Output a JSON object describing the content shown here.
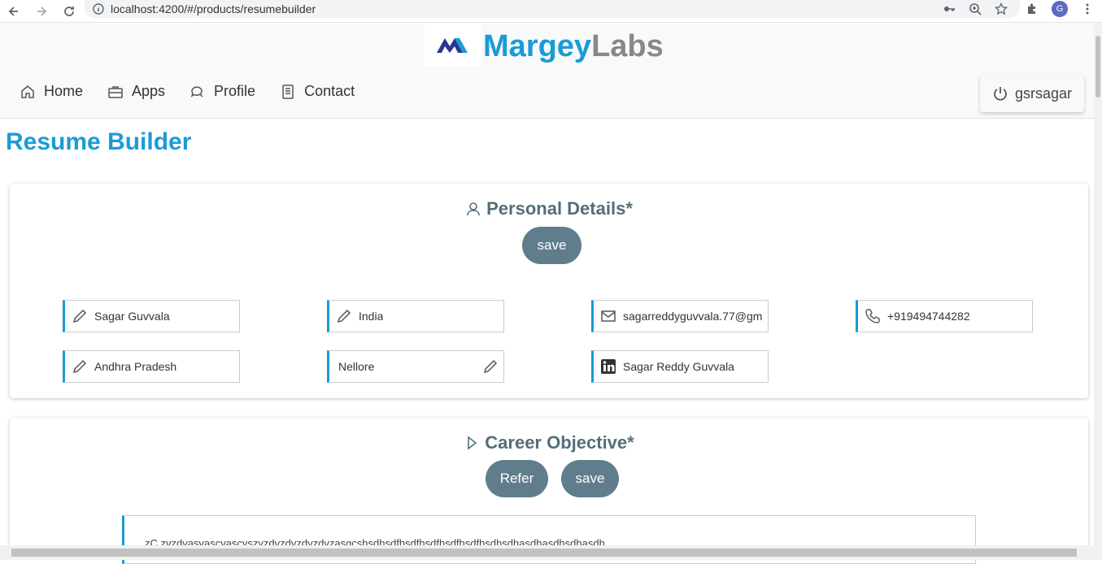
{
  "browser": {
    "url": "localhost:4200/#/products/resumebuilder",
    "profile_initial": "G"
  },
  "header": {
    "logo_primary": "Margey",
    "logo_secondary": "Labs",
    "nav": [
      {
        "label": "Home",
        "icon": "home-icon"
      },
      {
        "label": "Apps",
        "icon": "briefcase-icon"
      },
      {
        "label": "Profile",
        "icon": "chat-icon"
      },
      {
        "label": "Contact",
        "icon": "document-icon"
      }
    ],
    "user_label": "gsrsagar"
  },
  "page": {
    "title": "Resume Builder"
  },
  "personal_details": {
    "title": "Personal Details*",
    "save_label": "save",
    "fields": {
      "name": "Sagar Guvvala",
      "country": "India",
      "email": "sagarreddyguvvala.77@gm",
      "phone": "+919494744282",
      "state": "Andhra Pradesh",
      "city": "Nellore",
      "linkedin": "Sagar Reddy Guvvala"
    }
  },
  "career_objective": {
    "title": "Career Objective*",
    "refer_label": "Refer",
    "save_label": "save",
    "text": "zC zvzdvasvascvascvszvzdvzdvzdvzdvzasgcshsdhsdfhsdfhsdfhsdfhsdfhsdhsdhasdhasdhsdhasdh"
  },
  "colors": {
    "brand_blue": "#1a9bd7",
    "button_gray": "#607d8b",
    "title_gray": "#546e7a"
  }
}
